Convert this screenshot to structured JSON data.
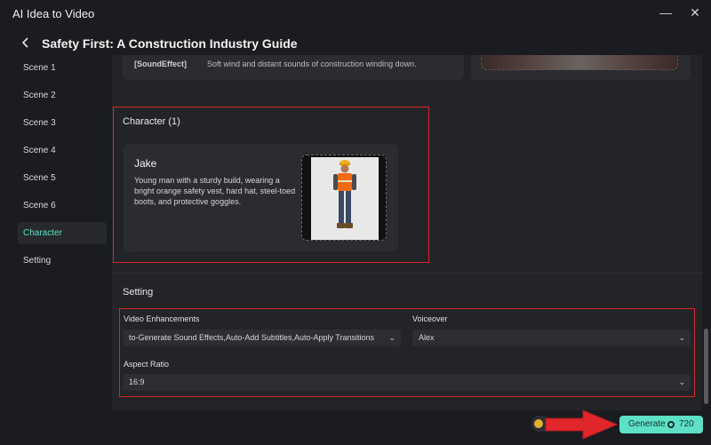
{
  "app": {
    "title": "AI Idea to Video"
  },
  "window": {
    "minimize_icon": "minimize-icon",
    "close_icon": "close-icon"
  },
  "header": {
    "back_icon": "chevron-left-icon",
    "title": "Safety First: A Construction Industry Guide"
  },
  "sidebar": {
    "items": [
      {
        "label": "Scene 1"
      },
      {
        "label": "Scene 2"
      },
      {
        "label": "Scene 3"
      },
      {
        "label": "Scene 4"
      },
      {
        "label": "Scene 5"
      },
      {
        "label": "Scene 6"
      },
      {
        "label": "Character",
        "active": true
      },
      {
        "label": "Setting"
      }
    ]
  },
  "scene": {
    "sound_effect_tag": "[SoundEffect]",
    "sound_effect_text": "Soft wind and distant sounds of construction winding down."
  },
  "character": {
    "heading": "Character (1)",
    "items": [
      {
        "name": "Jake",
        "description": "Young man with a sturdy build, wearing a bright orange safety vest, hard hat, steel-toed boots, and protective goggles."
      }
    ]
  },
  "setting": {
    "heading": "Setting",
    "video_enhancements": {
      "label": "Video Enhancements",
      "value": "to-Generate Sound Effects,Auto-Add Subtitles,Auto-Apply Transitions"
    },
    "voiceover": {
      "label": "Voiceover",
      "value": "Alex"
    },
    "aspect_ratio": {
      "label": "Aspect Ratio",
      "value": "16:9"
    }
  },
  "footer": {
    "generate_label": "Generate",
    "credits": "720",
    "credit_icon": "credit-coin-icon"
  },
  "colors": {
    "accent": "#5ee0c5",
    "highlight": "#d9262b",
    "background": "#1b1c1f",
    "panel": "#232428"
  }
}
